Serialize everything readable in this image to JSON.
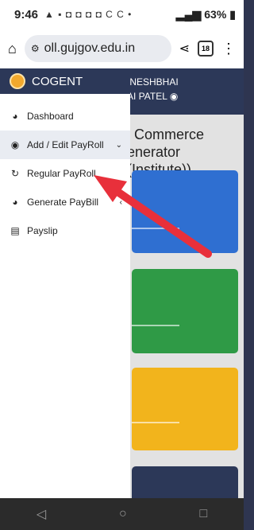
{
  "status_bar": {
    "time": "9:46",
    "notifications": "▲ ▪ ◘ ◘ ◘ ◘ C C •",
    "signal": "📶",
    "battery": "63%"
  },
  "browser": {
    "url": "oll.gujgov.edu.in",
    "tabs": "18"
  },
  "page": {
    "user_line1": "INESHBHAI",
    "user_line2": "AI PATEL",
    "heading_line1": "l Commerce",
    "heading_line2": "enerator (Institute))"
  },
  "sidebar": {
    "brand": "COGENT",
    "items": [
      {
        "label": "Dashboard",
        "icon": "dashboard-icon",
        "glyph": "◕"
      },
      {
        "label": "Add / Edit PayRoll",
        "icon": "user-circle-icon",
        "glyph": "◉"
      },
      {
        "label": "Regular PayRoll",
        "icon": "history-icon",
        "glyph": "↻"
      },
      {
        "label": "Generate PayBill",
        "icon": "dashboard-icon",
        "glyph": "◕"
      },
      {
        "label": "Payslip",
        "icon": "document-icon",
        "glyph": "▤"
      }
    ]
  },
  "cards": [
    {
      "color": "#2f6fd1"
    },
    {
      "color": "#2f9a46"
    },
    {
      "color": "#f2b41c"
    },
    {
      "color": "#2c3858"
    }
  ],
  "annotation": {
    "color": "#e8303b"
  }
}
